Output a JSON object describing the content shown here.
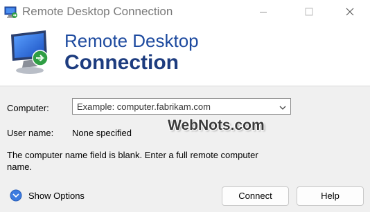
{
  "window": {
    "title": "Remote Desktop Connection",
    "controls": [
      "minimize",
      "maximize",
      "close"
    ]
  },
  "banner": {
    "line1": "Remote Desktop",
    "line2": "Connection"
  },
  "form": {
    "computer_label": "Computer:",
    "computer_placeholder": "Example: computer.fabrikam.com",
    "username_label": "User name:",
    "username_value": "None specified",
    "message": "The computer name field is blank. Enter a full remote computer name."
  },
  "footer": {
    "show_options": "Show Options",
    "connect": "Connect",
    "help": "Help"
  },
  "watermark": "WebNots.com",
  "colors": {
    "banner_text": "#1d4a9f",
    "window_bg": "#f0f0f0",
    "options_circle": "#3c7be0"
  },
  "icons": {
    "app": "remote-desktop-icon",
    "banner": "remote-desktop-monitor-icon",
    "dropdown": "chevron-down-icon",
    "options": "expand-circle-icon"
  }
}
